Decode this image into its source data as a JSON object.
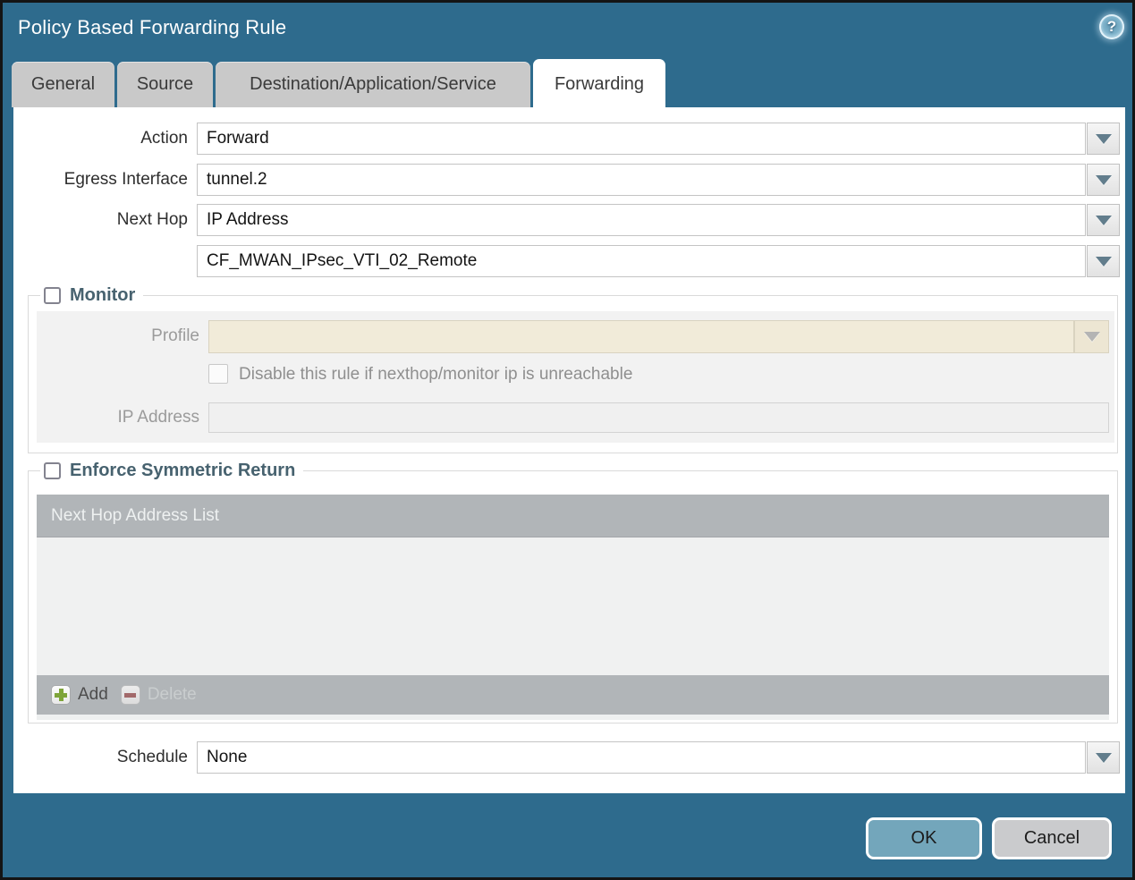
{
  "dialog": {
    "title": "Policy Based Forwarding Rule"
  },
  "tabs": [
    {
      "label": "General",
      "active": false
    },
    {
      "label": "Source",
      "active": false
    },
    {
      "label": "Destination/Application/Service",
      "active": false
    },
    {
      "label": "Forwarding",
      "active": true
    }
  ],
  "form": {
    "action": {
      "label": "Action",
      "value": "Forward"
    },
    "egress_interface": {
      "label": "Egress Interface",
      "value": "tunnel.2"
    },
    "next_hop": {
      "label": "Next Hop",
      "value": "IP Address"
    },
    "next_hop_address": {
      "value": "CF_MWAN_IPsec_VTI_02_Remote"
    },
    "schedule": {
      "label": "Schedule",
      "value": "None"
    }
  },
  "monitor": {
    "legend": "Monitor",
    "checked": false,
    "profile": {
      "label": "Profile",
      "value": ""
    },
    "disable_rule_checkbox": {
      "label": "Disable this rule if nexthop/monitor ip is unreachable",
      "checked": false
    },
    "ip_address": {
      "label": "IP Address",
      "value": ""
    }
  },
  "symmetric_return": {
    "legend": "Enforce Symmetric Return",
    "checked": false,
    "table": {
      "header": "Next Hop Address List",
      "rows": []
    },
    "add_label": "Add",
    "delete_label": "Delete"
  },
  "footer": {
    "ok_label": "OK",
    "cancel_label": "Cancel"
  },
  "icons": {
    "help": "help-icon",
    "dropdown": "chevron-down-icon",
    "add": "plus-icon",
    "delete": "minus-icon"
  },
  "colors": {
    "frame_teal": "#2e6b8d",
    "tab_inactive": "#c9c9c9",
    "legend_text": "#47626f",
    "profile_disabled_bg": "#f1ebd9",
    "table_bar": "#b1b5b8",
    "ok_button": "#73a6bb",
    "cancel_button": "#cacbcd",
    "add_plus": "#7ea43a",
    "delete_minus": "#a2696a"
  }
}
